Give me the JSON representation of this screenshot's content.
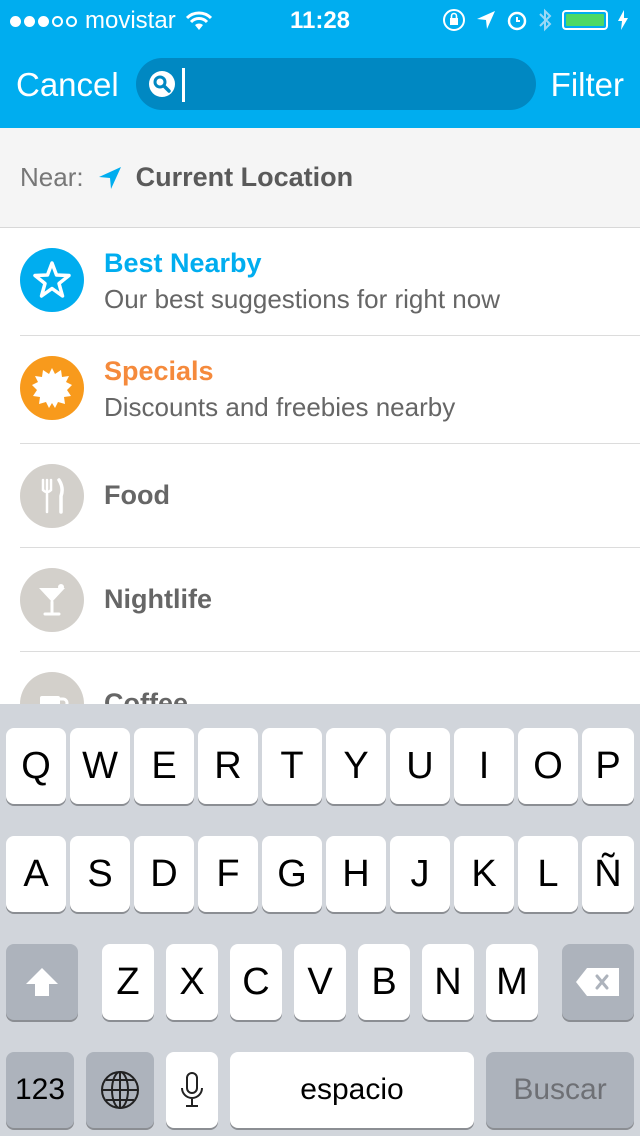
{
  "status_bar": {
    "carrier": "movistar",
    "time": "11:28"
  },
  "nav": {
    "cancel_label": "Cancel",
    "filter_label": "Filter",
    "search_value": "",
    "search_placeholder": ""
  },
  "near": {
    "label": "Near:",
    "location": "Current Location"
  },
  "categories": [
    {
      "title": "Best Nearby",
      "subtitle": "Our best suggestions for right now",
      "icon": "star-icon",
      "color": "#00adef"
    },
    {
      "title": "Specials",
      "subtitle": "Discounts and freebies nearby",
      "icon": "burst-icon",
      "color": "#f89a1c"
    },
    {
      "title": "Food",
      "icon": "fork-knife-icon",
      "color": "#d3d0cb"
    },
    {
      "title": "Nightlife",
      "icon": "cocktail-icon",
      "color": "#d3d0cb"
    },
    {
      "title": "Coffee",
      "icon": "coffee-cup-icon",
      "color": "#d3d0cb"
    }
  ],
  "keyboard": {
    "row1": [
      "Q",
      "W",
      "E",
      "R",
      "T",
      "Y",
      "U",
      "I",
      "O",
      "P"
    ],
    "row2": [
      "A",
      "S",
      "D",
      "F",
      "G",
      "H",
      "J",
      "K",
      "L",
      "Ñ"
    ],
    "row3": [
      "Z",
      "X",
      "C",
      "V",
      "B",
      "N",
      "M"
    ],
    "numbers_label": "123",
    "space_label": "espacio",
    "search_label": "Buscar"
  },
  "colors": {
    "brand": "#00adef",
    "specials": "#f89a1c",
    "battery": "#4cd964"
  }
}
